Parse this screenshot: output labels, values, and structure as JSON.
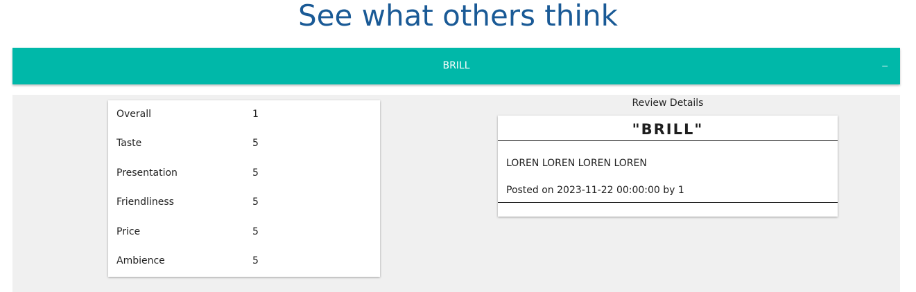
{
  "page": {
    "title": "See what others think"
  },
  "accordion": {
    "title": "BRILL",
    "toggle_symbol": "–"
  },
  "ratings": [
    {
      "label": "Overall",
      "value": "1"
    },
    {
      "label": "Taste",
      "value": "5"
    },
    {
      "label": "Presentation",
      "value": "5"
    },
    {
      "label": "Friendliness",
      "value": "5"
    },
    {
      "label": "Price",
      "value": "5"
    },
    {
      "label": "Ambience",
      "value": "5"
    }
  ],
  "review": {
    "heading": "Review Details",
    "title": "\"BRILL\"",
    "body": "LOREN LOREN LOREN LOREN",
    "posted_prefix": "Posted on",
    "posted_date": "2023-11-22 00:00:00",
    "posted_by_prefix": "by",
    "author": "1"
  },
  "colors": {
    "title_color": "#1a5a96",
    "accent": "#00b8a9",
    "panel_bg": "#f0f0f0"
  }
}
